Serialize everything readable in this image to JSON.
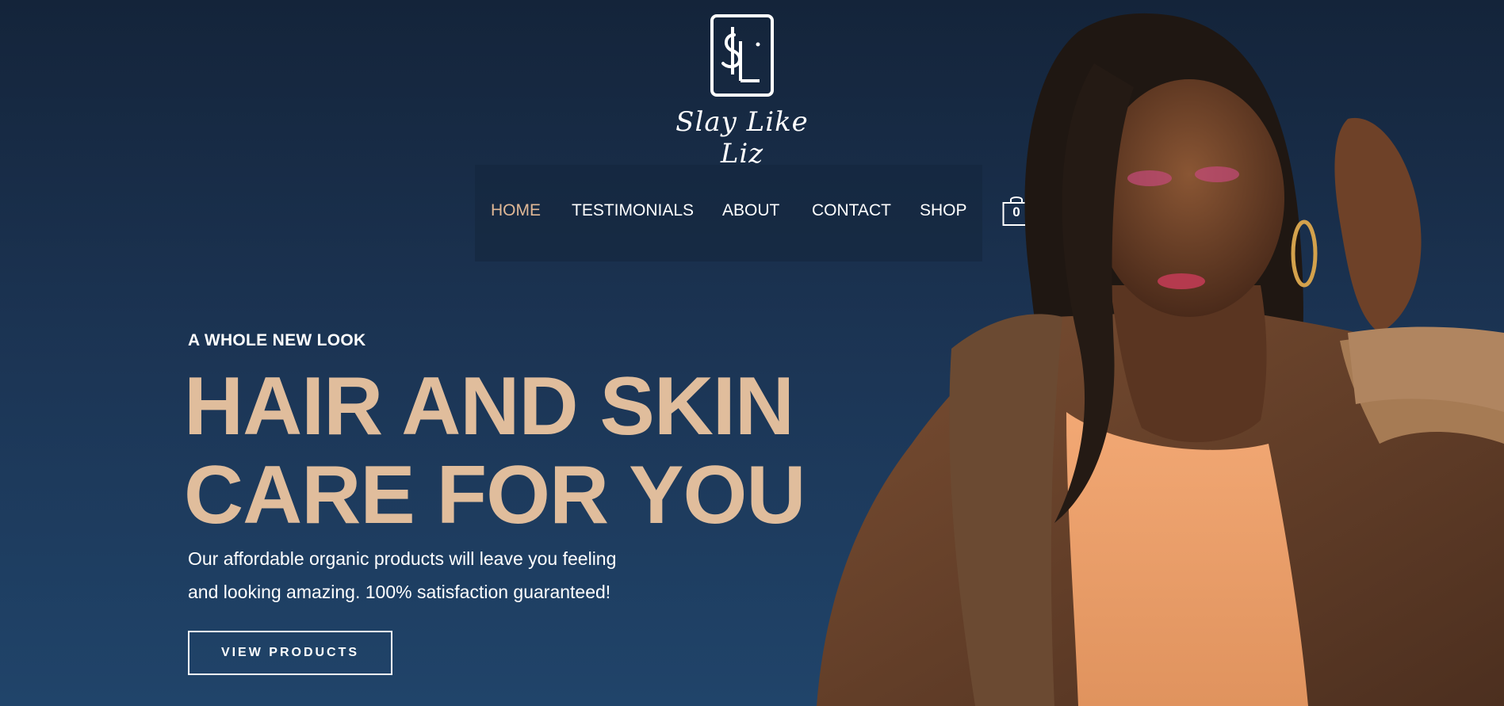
{
  "brand": {
    "monogram": "$L",
    "script_name": "Slay Like Liz"
  },
  "nav": {
    "items": [
      {
        "label": "HOME",
        "active": true
      },
      {
        "label": "TESTIMONIALS",
        "active": false
      },
      {
        "label": "ABOUT",
        "active": false
      },
      {
        "label": "CONTACT",
        "active": false
      },
      {
        "label": "SHOP",
        "active": false
      }
    ]
  },
  "cart": {
    "count": "0",
    "icon": "shopping-bag-icon"
  },
  "hero": {
    "eyebrow": "A WHOLE NEW LOOK",
    "headline_line1": "HAIR AND SKIN",
    "headline_line2": "CARE FOR YOU",
    "body_line1": "Our affordable organic products will leave you feeling",
    "body_line2": "and looking amazing. 100% satisfaction guaranteed!",
    "cta_label": "VIEW PRODUCTS"
  },
  "colors": {
    "bg_top": "#14243a",
    "bg_bottom": "#20446a",
    "accent": "#e0bd9c",
    "nav_active": "#e0b896",
    "text": "#ffffff"
  }
}
